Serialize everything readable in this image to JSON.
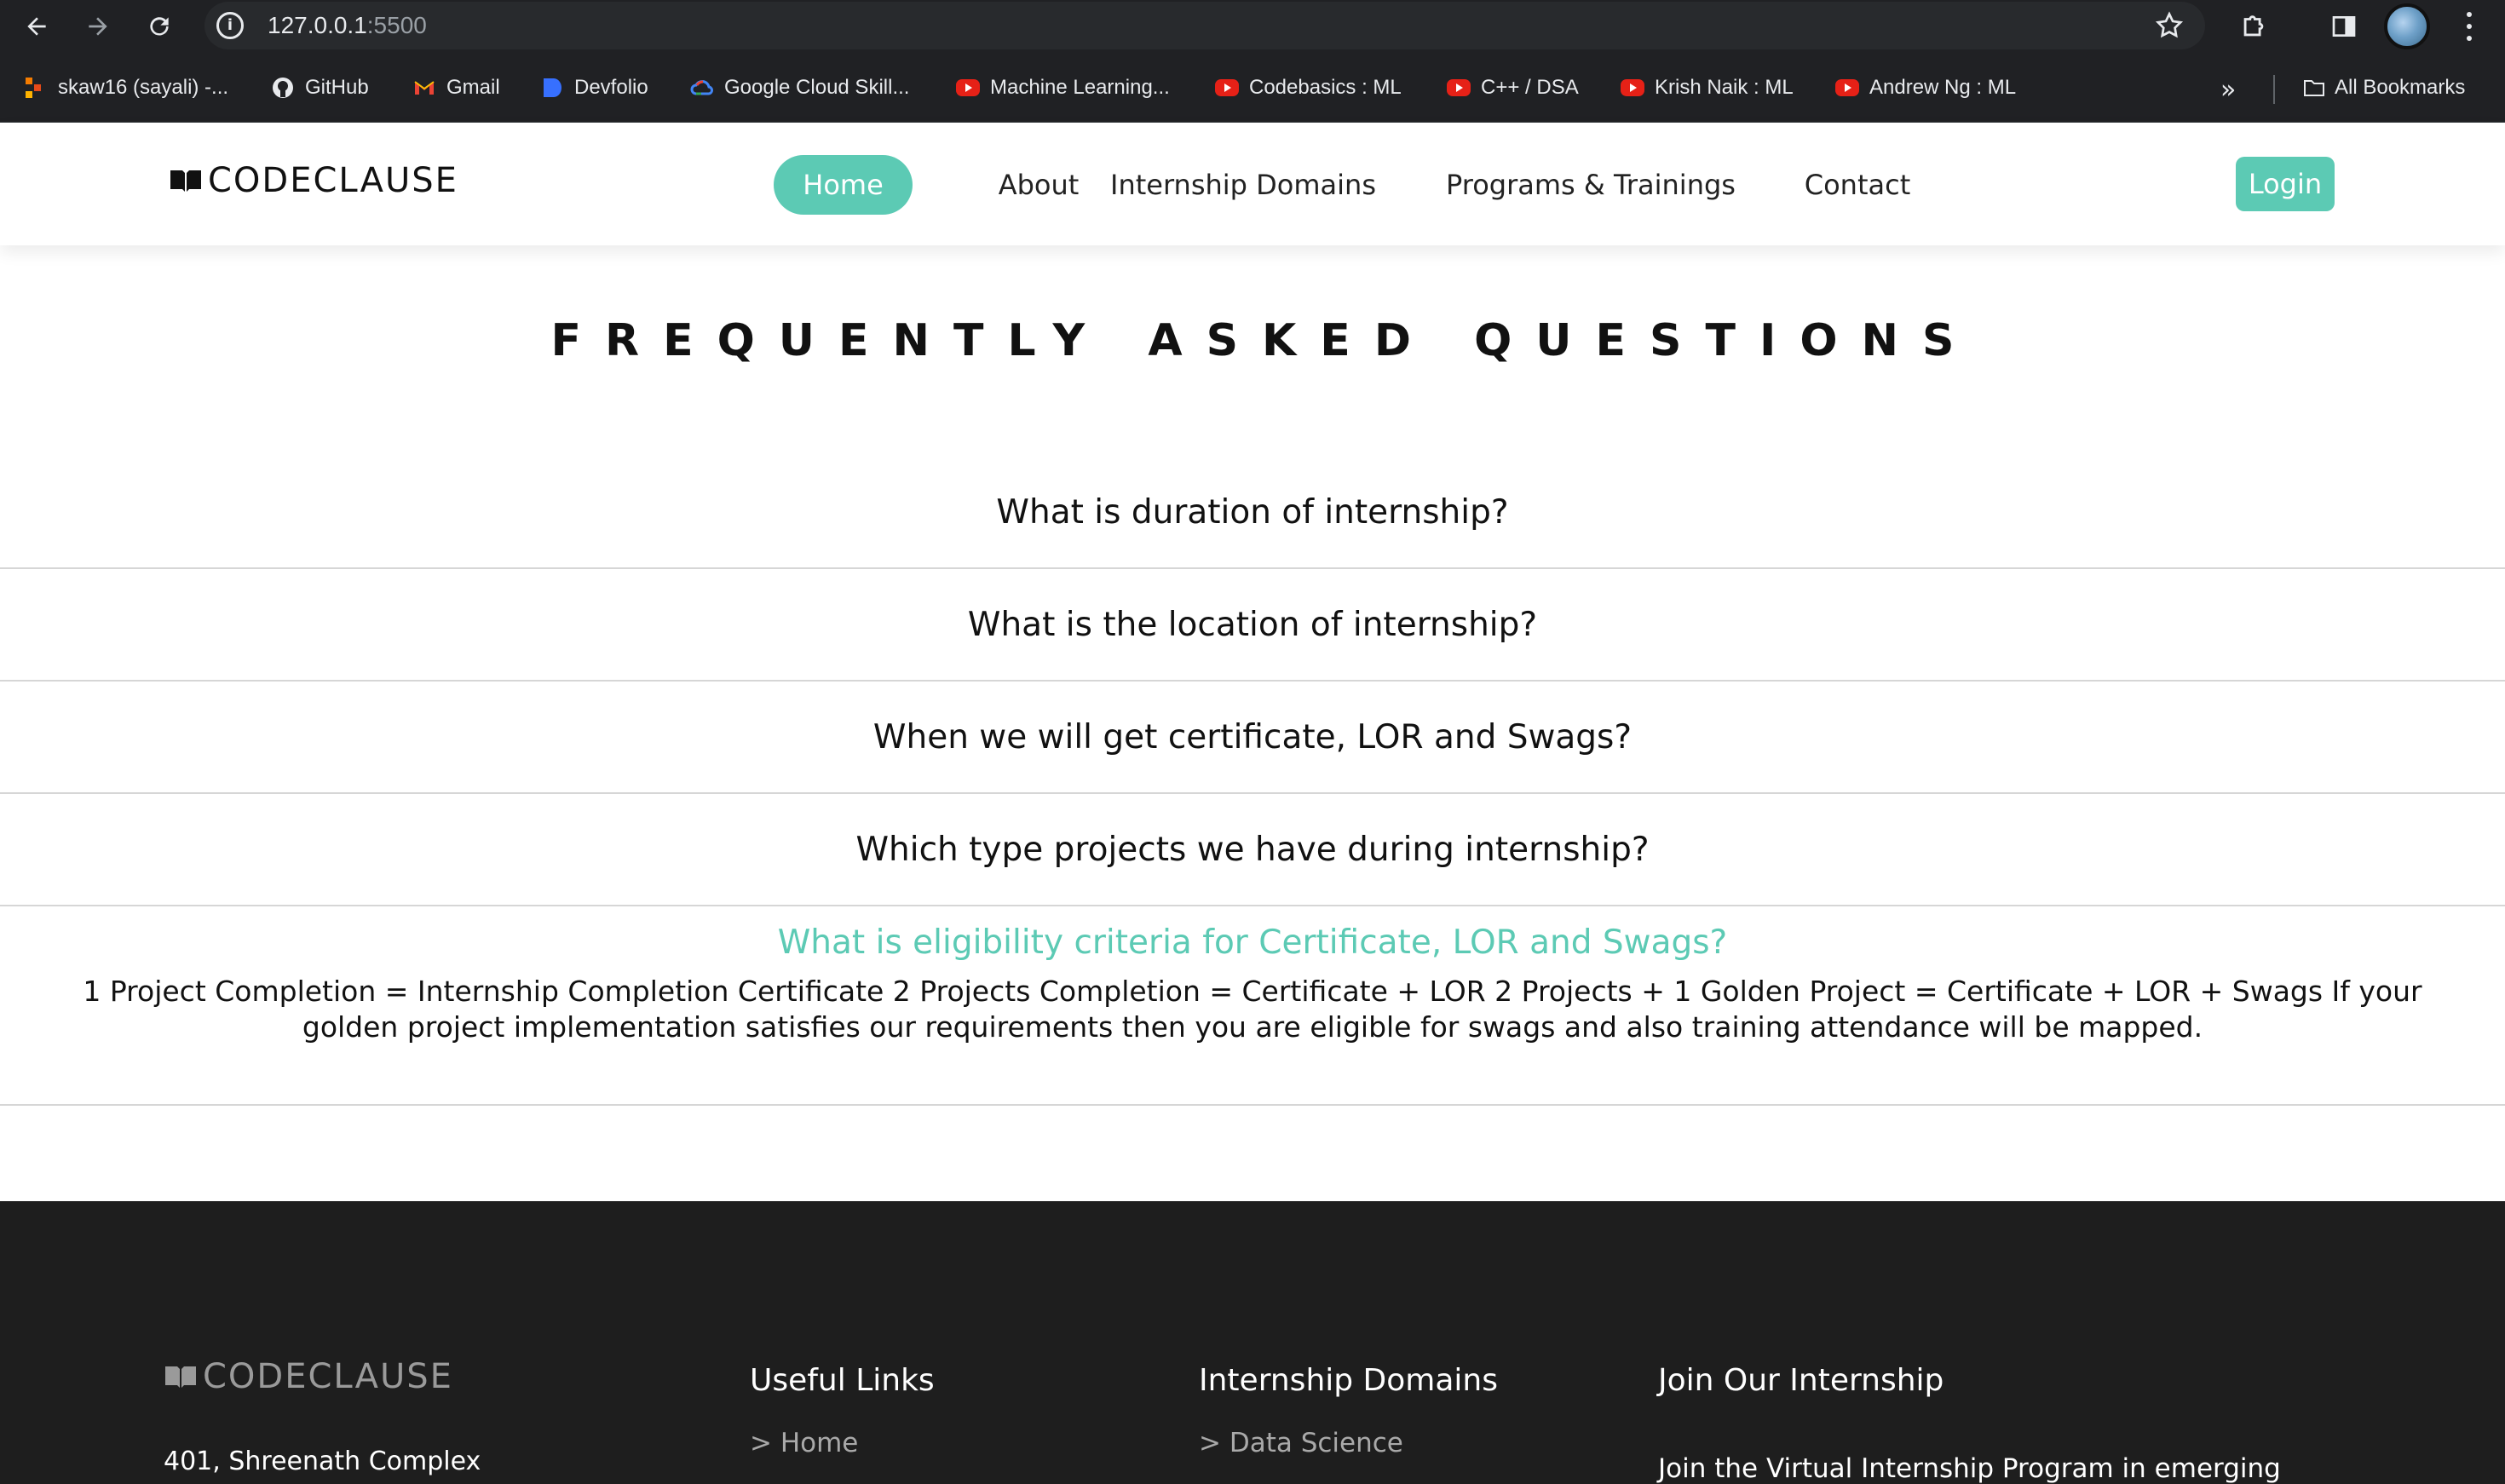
{
  "browser": {
    "url_host": "127.0.0.1",
    "url_port": ":5500",
    "bookmarks": [
      {
        "label": "skaw16 (sayali) -...",
        "icon": "colorful-squares-icon"
      },
      {
        "label": "GitHub",
        "icon": "github-icon"
      },
      {
        "label": "Gmail",
        "icon": "gmail-icon"
      },
      {
        "label": "Devfolio",
        "icon": "devfolio-icon"
      },
      {
        "label": "Google Cloud Skill...",
        "icon": "google-cloud-icon"
      },
      {
        "label": "Machine Learning...",
        "icon": "youtube-icon"
      },
      {
        "label": "Codebasics : ML",
        "icon": "youtube-icon"
      },
      {
        "label": "C++ / DSA",
        "icon": "youtube-icon"
      },
      {
        "label": "Krish Naik : ML",
        "icon": "youtube-icon"
      },
      {
        "label": "Andrew Ng : ML",
        "icon": "youtube-icon"
      }
    ],
    "all_bookmarks": "All Bookmarks",
    "overflow": "»"
  },
  "header": {
    "logo_text": "CODECLAUSE",
    "menu": [
      "Home",
      "About",
      "Internship Domains",
      "Programs & Trainings",
      "Contact"
    ],
    "active_index": 0,
    "login_label": "Login",
    "accent_color": "#5ccab4"
  },
  "faq": {
    "title": "FREQUENTLY ASKED QUESTIONS",
    "items": [
      {
        "question": "What is duration of internship?"
      },
      {
        "question": "What is the location of internship?"
      },
      {
        "question": "When we will get certificate, LOR and Swags?"
      },
      {
        "question": "Which type projects we have during internship?"
      },
      {
        "question": "What is eligibility criteria for Certificate, LOR and Swags?",
        "answer": "1 Project Completion = Internship Completion Certificate 2 Projects Completion = Certificate + LOR 2 Projects + 1 Golden Project = Certificate + LOR + Swags If your golden project implementation satisfies our requirements then you are eligible for swags and also training attendance will be mapped."
      }
    ]
  },
  "footer": {
    "logo_text": "CODECLAUSE",
    "address": "401, Shreenath Complex",
    "useful_links_title": "Useful Links",
    "useful_links": [
      "> Home"
    ],
    "domains_title": "Internship Domains",
    "domains": [
      "> Data Science"
    ],
    "join_title": "Join Our Internship",
    "join_text": "Join the Virtual Internship Program in emerging"
  }
}
